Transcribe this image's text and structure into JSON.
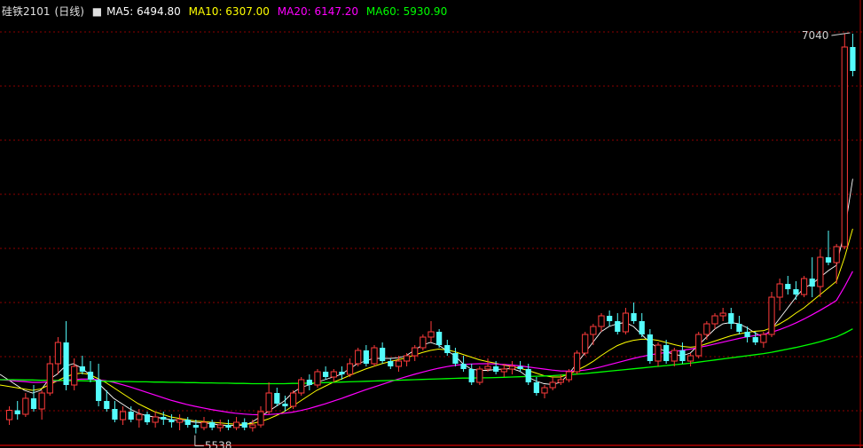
{
  "header": {
    "symbol": "硅铁2101",
    "period": "(日线)",
    "ma5": "MA5: 6494.80",
    "ma10": "MA10: 6307.00",
    "ma20": "MA20: 6147.20",
    "ma60": "MA60: 5930.90"
  },
  "colors": {
    "up": "#ff3b3b",
    "down": "#54fcfc",
    "ma5": "#ffffff",
    "ma10": "#ffff00",
    "ma20": "#ff00ff",
    "ma60": "#00ff00",
    "grid": "#8b0000"
  },
  "chart_data": {
    "type": "candlestick",
    "title": "硅铁2101 (日线)",
    "ylim": [
      5500,
      7080
    ],
    "annotations": [
      {
        "label": "7040",
        "value": 7040,
        "type": "high"
      },
      {
        "label": "5538",
        "value": 5538,
        "type": "low"
      }
    ],
    "candles": [
      [
        5590,
        5640,
        5570,
        5625
      ],
      [
        5625,
        5660,
        5590,
        5610
      ],
      [
        5610,
        5690,
        5600,
        5670
      ],
      [
        5670,
        5720,
        5620,
        5630
      ],
      [
        5630,
        5700,
        5590,
        5690
      ],
      [
        5690,
        5830,
        5680,
        5800
      ],
      [
        5800,
        5900,
        5760,
        5880
      ],
      [
        5880,
        5960,
        5700,
        5720
      ],
      [
        5720,
        5820,
        5700,
        5790
      ],
      [
        5790,
        5830,
        5760,
        5770
      ],
      [
        5770,
        5810,
        5730,
        5740
      ],
      [
        5740,
        5800,
        5640,
        5660
      ],
      [
        5660,
        5700,
        5620,
        5630
      ],
      [
        5630,
        5660,
        5580,
        5590
      ],
      [
        5590,
        5640,
        5570,
        5620
      ],
      [
        5620,
        5640,
        5580,
        5590
      ],
      [
        5590,
        5630,
        5560,
        5610
      ],
      [
        5610,
        5620,
        5570,
        5580
      ],
      [
        5580,
        5620,
        5560,
        5600
      ],
      [
        5600,
        5620,
        5570,
        5590
      ],
      [
        5590,
        5610,
        5560,
        5580
      ],
      [
        5580,
        5610,
        5550,
        5590
      ],
      [
        5590,
        5600,
        5560,
        5570
      ],
      [
        5570,
        5590,
        5538,
        5560
      ],
      [
        5560,
        5600,
        5550,
        5580
      ],
      [
        5580,
        5590,
        5550,
        5560
      ],
      [
        5560,
        5590,
        5545,
        5570
      ],
      [
        5570,
        5590,
        5550,
        5560
      ],
      [
        5560,
        5600,
        5550,
        5580
      ],
      [
        5580,
        5595,
        5550,
        5560
      ],
      [
        5560,
        5590,
        5545,
        5570
      ],
      [
        5570,
        5640,
        5560,
        5620
      ],
      [
        5620,
        5730,
        5610,
        5690
      ],
      [
        5690,
        5710,
        5640,
        5650
      ],
      [
        5650,
        5680,
        5620,
        5640
      ],
      [
        5640,
        5700,
        5630,
        5690
      ],
      [
        5690,
        5750,
        5680,
        5740
      ],
      [
        5740,
        5760,
        5700,
        5720
      ],
      [
        5720,
        5780,
        5710,
        5770
      ],
      [
        5770,
        5790,
        5740,
        5750
      ],
      [
        5750,
        5780,
        5730,
        5770
      ],
      [
        5770,
        5790,
        5740,
        5760
      ],
      [
        5760,
        5820,
        5750,
        5800
      ],
      [
        5800,
        5860,
        5790,
        5850
      ],
      [
        5850,
        5870,
        5790,
        5800
      ],
      [
        5800,
        5870,
        5790,
        5860
      ],
      [
        5860,
        5880,
        5800,
        5810
      ],
      [
        5810,
        5820,
        5780,
        5790
      ],
      [
        5790,
        5830,
        5770,
        5810
      ],
      [
        5810,
        5840,
        5790,
        5830
      ],
      [
        5830,
        5870,
        5810,
        5860
      ],
      [
        5860,
        5910,
        5850,
        5900
      ],
      [
        5900,
        5960,
        5880,
        5920
      ],
      [
        5920,
        5930,
        5860,
        5870
      ],
      [
        5870,
        5890,
        5830,
        5840
      ],
      [
        5840,
        5860,
        5790,
        5800
      ],
      [
        5800,
        5830,
        5770,
        5780
      ],
      [
        5780,
        5800,
        5720,
        5730
      ],
      [
        5730,
        5790,
        5720,
        5780
      ],
      [
        5780,
        5820,
        5770,
        5790
      ],
      [
        5790,
        5810,
        5760,
        5770
      ],
      [
        5770,
        5800,
        5750,
        5780
      ],
      [
        5780,
        5810,
        5760,
        5790
      ],
      [
        5790,
        5810,
        5770,
        5780
      ],
      [
        5780,
        5800,
        5720,
        5730
      ],
      [
        5730,
        5750,
        5680,
        5690
      ],
      [
        5690,
        5720,
        5670,
        5710
      ],
      [
        5710,
        5750,
        5700,
        5730
      ],
      [
        5730,
        5760,
        5720,
        5740
      ],
      [
        5740,
        5780,
        5730,
        5770
      ],
      [
        5770,
        5850,
        5760,
        5840
      ],
      [
        5840,
        5920,
        5830,
        5910
      ],
      [
        5910,
        5950,
        5870,
        5940
      ],
      [
        5940,
        5990,
        5920,
        5980
      ],
      [
        5980,
        6000,
        5940,
        5960
      ],
      [
        5960,
        5990,
        5910,
        5920
      ],
      [
        5920,
        6010,
        5910,
        5990
      ],
      [
        5990,
        6030,
        5950,
        5960
      ],
      [
        5960,
        5990,
        5900,
        5910
      ],
      [
        5910,
        5930,
        5800,
        5810
      ],
      [
        5810,
        5880,
        5790,
        5870
      ],
      [
        5870,
        5890,
        5800,
        5810
      ],
      [
        5810,
        5860,
        5790,
        5850
      ],
      [
        5850,
        5880,
        5800,
        5810
      ],
      [
        5810,
        5840,
        5790,
        5830
      ],
      [
        5830,
        5920,
        5820,
        5910
      ],
      [
        5910,
        5960,
        5890,
        5950
      ],
      [
        5950,
        5990,
        5930,
        5980
      ],
      [
        5980,
        6010,
        5960,
        5990
      ],
      [
        5990,
        6010,
        5930,
        5950
      ],
      [
        5950,
        5980,
        5910,
        5920
      ],
      [
        5920,
        5940,
        5880,
        5900
      ],
      [
        5900,
        5920,
        5870,
        5880
      ],
      [
        5880,
        5920,
        5860,
        5910
      ],
      [
        5910,
        6070,
        5900,
        6050
      ],
      [
        6050,
        6120,
        6000,
        6100
      ],
      [
        6100,
        6130,
        6060,
        6080
      ],
      [
        6080,
        6110,
        6040,
        6060
      ],
      [
        6060,
        6130,
        6050,
        6120
      ],
      [
        6120,
        6200,
        6050,
        6090
      ],
      [
        6090,
        6230,
        6050,
        6200
      ],
      [
        6200,
        6300,
        6170,
        6180
      ],
      [
        6180,
        6250,
        6100,
        6240
      ],
      [
        6240,
        7040,
        6230,
        6990
      ],
      [
        6990,
        7040,
        6880,
        6900
      ]
    ],
    "ma_series": [
      {
        "name": "MA5",
        "value": 6494.8,
        "values": [
          5760,
          5740,
          5720,
          5700,
          5690,
          5700,
          5740,
          5760,
          5790,
          5800,
          5785,
          5760,
          5730,
          5700,
          5670,
          5650,
          5630,
          5615,
          5605,
          5600,
          5595,
          5590,
          5588,
          5585,
          5580,
          5578,
          5575,
          5570,
          5568,
          5568,
          5568,
          5580,
          5600,
          5620,
          5640,
          5660,
          5690,
          5710,
          5720,
          5730,
          5740,
          5750,
          5760,
          5780,
          5800,
          5810,
          5820,
          5820,
          5820,
          5822,
          5830,
          5850,
          5870,
          5880,
          5870,
          5850,
          5830,
          5800,
          5780,
          5775,
          5775,
          5778,
          5780,
          5782,
          5772,
          5750,
          5735,
          5725,
          5722,
          5730,
          5760,
          5800,
          5840,
          5880,
          5920,
          5940,
          5950,
          5955,
          5940,
          5910,
          5880,
          5860,
          5845,
          5835,
          5830,
          5840,
          5870,
          5900,
          5930,
          5950,
          5955,
          5950,
          5935,
          5915,
          5900,
          5930,
          5970,
          6010,
          6050,
          6085,
          6100,
          6125,
          6150,
          6170,
          6300,
          6494.8
        ]
      },
      {
        "name": "MA10",
        "value": 6307.0,
        "values": [
          5720,
          5715,
          5710,
          5705,
          5700,
          5705,
          5720,
          5735,
          5750,
          5760,
          5765,
          5760,
          5745,
          5730,
          5710,
          5690,
          5670,
          5650,
          5635,
          5620,
          5610,
          5600,
          5595,
          5590,
          5585,
          5583,
          5580,
          5578,
          5575,
          5573,
          5572,
          5575,
          5582,
          5592,
          5605,
          5620,
          5640,
          5660,
          5680,
          5700,
          5715,
          5730,
          5742,
          5755,
          5768,
          5780,
          5790,
          5800,
          5808,
          5815,
          5822,
          5832,
          5842,
          5850,
          5855,
          5852,
          5845,
          5835,
          5825,
          5815,
          5808,
          5802,
          5795,
          5790,
          5783,
          5775,
          5765,
          5755,
          5750,
          5750,
          5760,
          5775,
          5790,
          5808,
          5830,
          5850,
          5868,
          5880,
          5888,
          5892,
          5892,
          5888,
          5880,
          5872,
          5865,
          5862,
          5865,
          5875,
          5885,
          5895,
          5905,
          5912,
          5918,
          5922,
          5924,
          5935,
          5950,
          5968,
          5990,
          6010,
          6035,
          6060,
          6085,
          6110,
          6200,
          6307
        ]
      },
      {
        "name": "MA20",
        "value": 6147.2,
        "values": [
          5740,
          5738,
          5735,
          5733,
          5730,
          5730,
          5732,
          5735,
          5738,
          5740,
          5742,
          5742,
          5740,
          5736,
          5730,
          5722,
          5713,
          5703,
          5693,
          5683,
          5673,
          5663,
          5655,
          5647,
          5640,
          5634,
          5628,
          5623,
          5618,
          5614,
          5611,
          5609,
          5608,
          5609,
          5611,
          5614,
          5618,
          5624,
          5631,
          5640,
          5649,
          5659,
          5669,
          5680,
          5691,
          5702,
          5712,
          5722,
          5732,
          5742,
          5751,
          5760,
          5768,
          5776,
          5783,
          5789,
          5794,
          5797,
          5799,
          5800,
          5800,
          5799,
          5797,
          5795,
          5792,
          5788,
          5784,
          5780,
          5776,
          5773,
          5772,
          5773,
          5776,
          5781,
          5788,
          5796,
          5804,
          5812,
          5820,
          5827,
          5833,
          5838,
          5842,
          5846,
          5850,
          5855,
          5861,
          5867,
          5874,
          5881,
          5888,
          5895,
          5901,
          5906,
          5910,
          5918,
          5928,
          5940,
          5953,
          5968,
          5984,
          6001,
          6019,
          6038,
          6090,
          6147.2
        ]
      },
      {
        "name": "MA60",
        "value": 5930.9,
        "values": [
          5740,
          5740,
          5740,
          5739,
          5739,
          5738,
          5738,
          5737,
          5737,
          5736,
          5736,
          5735,
          5735,
          5734,
          5734,
          5733,
          5733,
          5732,
          5732,
          5731,
          5731,
          5730,
          5730,
          5729,
          5729,
          5728,
          5728,
          5727,
          5727,
          5726,
          5726,
          5725,
          5725,
          5725,
          5725,
          5725,
          5726,
          5726,
          5727,
          5728,
          5729,
          5730,
          5731,
          5732,
          5733,
          5734,
          5735,
          5736,
          5737,
          5738,
          5739,
          5740,
          5741,
          5742,
          5743,
          5744,
          5745,
          5746,
          5746,
          5747,
          5747,
          5748,
          5749,
          5750,
          5751,
          5752,
          5753,
          5754,
          5755,
          5757,
          5759,
          5761,
          5763,
          5766,
          5769,
          5772,
          5775,
          5778,
          5781,
          5784,
          5787,
          5790,
          5793,
          5796,
          5799,
          5802,
          5806,
          5810,
          5814,
          5818,
          5822,
          5826,
          5830,
          5834,
          5838,
          5843,
          5849,
          5855,
          5861,
          5868,
          5875,
          5883,
          5892,
          5901,
          5915,
          5930.9
        ]
      }
    ]
  }
}
